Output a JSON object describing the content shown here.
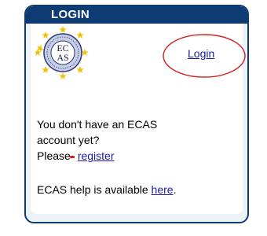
{
  "panel": {
    "title": "LOGIN"
  },
  "logo": {
    "text_top": "EC",
    "text_bottom": "AS",
    "icon": "ecas-seal-logo"
  },
  "login_link": {
    "label": "Login"
  },
  "account_text": {
    "line1": "You don't have an ECAS",
    "line2": "account yet?",
    "please": "Please",
    "register_label": "register"
  },
  "help_text": {
    "prefix": "ECAS help is available ",
    "link_label": "here",
    "suffix": "."
  },
  "colors": {
    "header": "#0e3b72",
    "panel_bg": "#edf2f8",
    "link": "#1a1aa6",
    "oval": "#d42020"
  }
}
